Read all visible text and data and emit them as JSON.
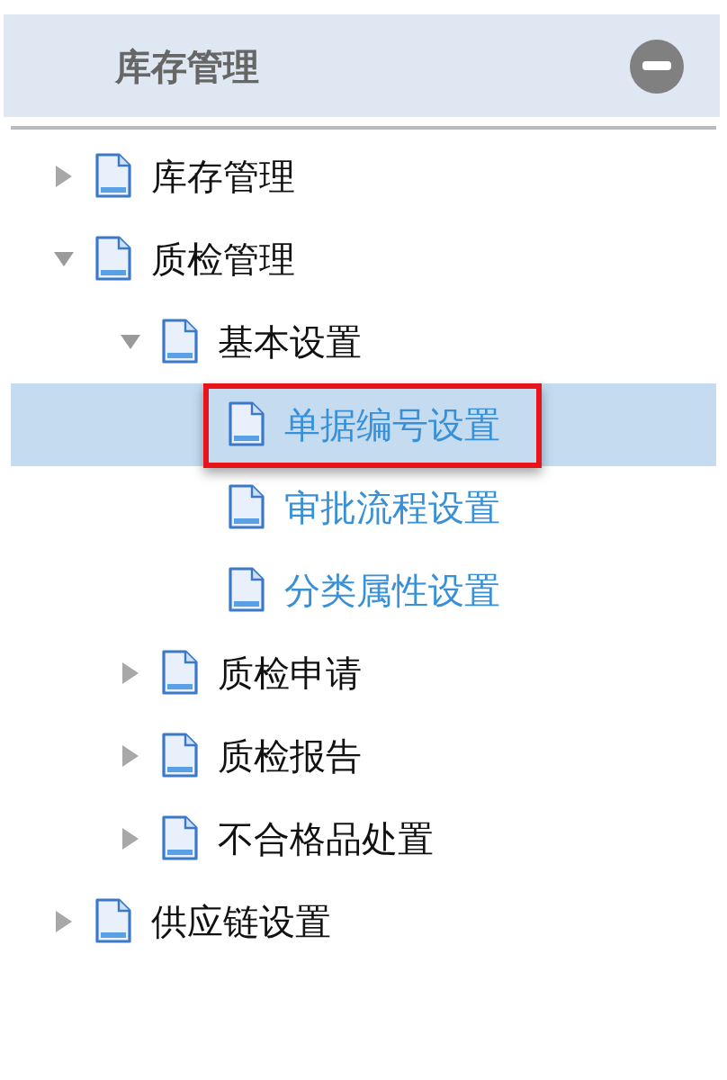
{
  "panel": {
    "title": "库存管理"
  },
  "tree": [
    {
      "label": "库存管理",
      "kind": "branch",
      "expanded": false,
      "selected": false
    },
    {
      "label": "质检管理",
      "kind": "branch",
      "expanded": true,
      "selected": false,
      "children": [
        {
          "label": "基本设置",
          "kind": "branch",
          "expanded": true,
          "selected": false,
          "children": [
            {
              "label": "单据编号设置",
              "kind": "leaf",
              "selected": true
            },
            {
              "label": "审批流程设置",
              "kind": "leaf",
              "selected": false
            },
            {
              "label": "分类属性设置",
              "kind": "leaf",
              "selected": false
            }
          ]
        },
        {
          "label": "质检申请",
          "kind": "branch",
          "expanded": false,
          "selected": false
        },
        {
          "label": "质检报告",
          "kind": "branch",
          "expanded": false,
          "selected": false
        },
        {
          "label": "不合格品处置",
          "kind": "branch",
          "expanded": false,
          "selected": false
        }
      ]
    },
    {
      "label": "供应链设置",
      "kind": "branch",
      "expanded": false,
      "selected": false
    }
  ]
}
